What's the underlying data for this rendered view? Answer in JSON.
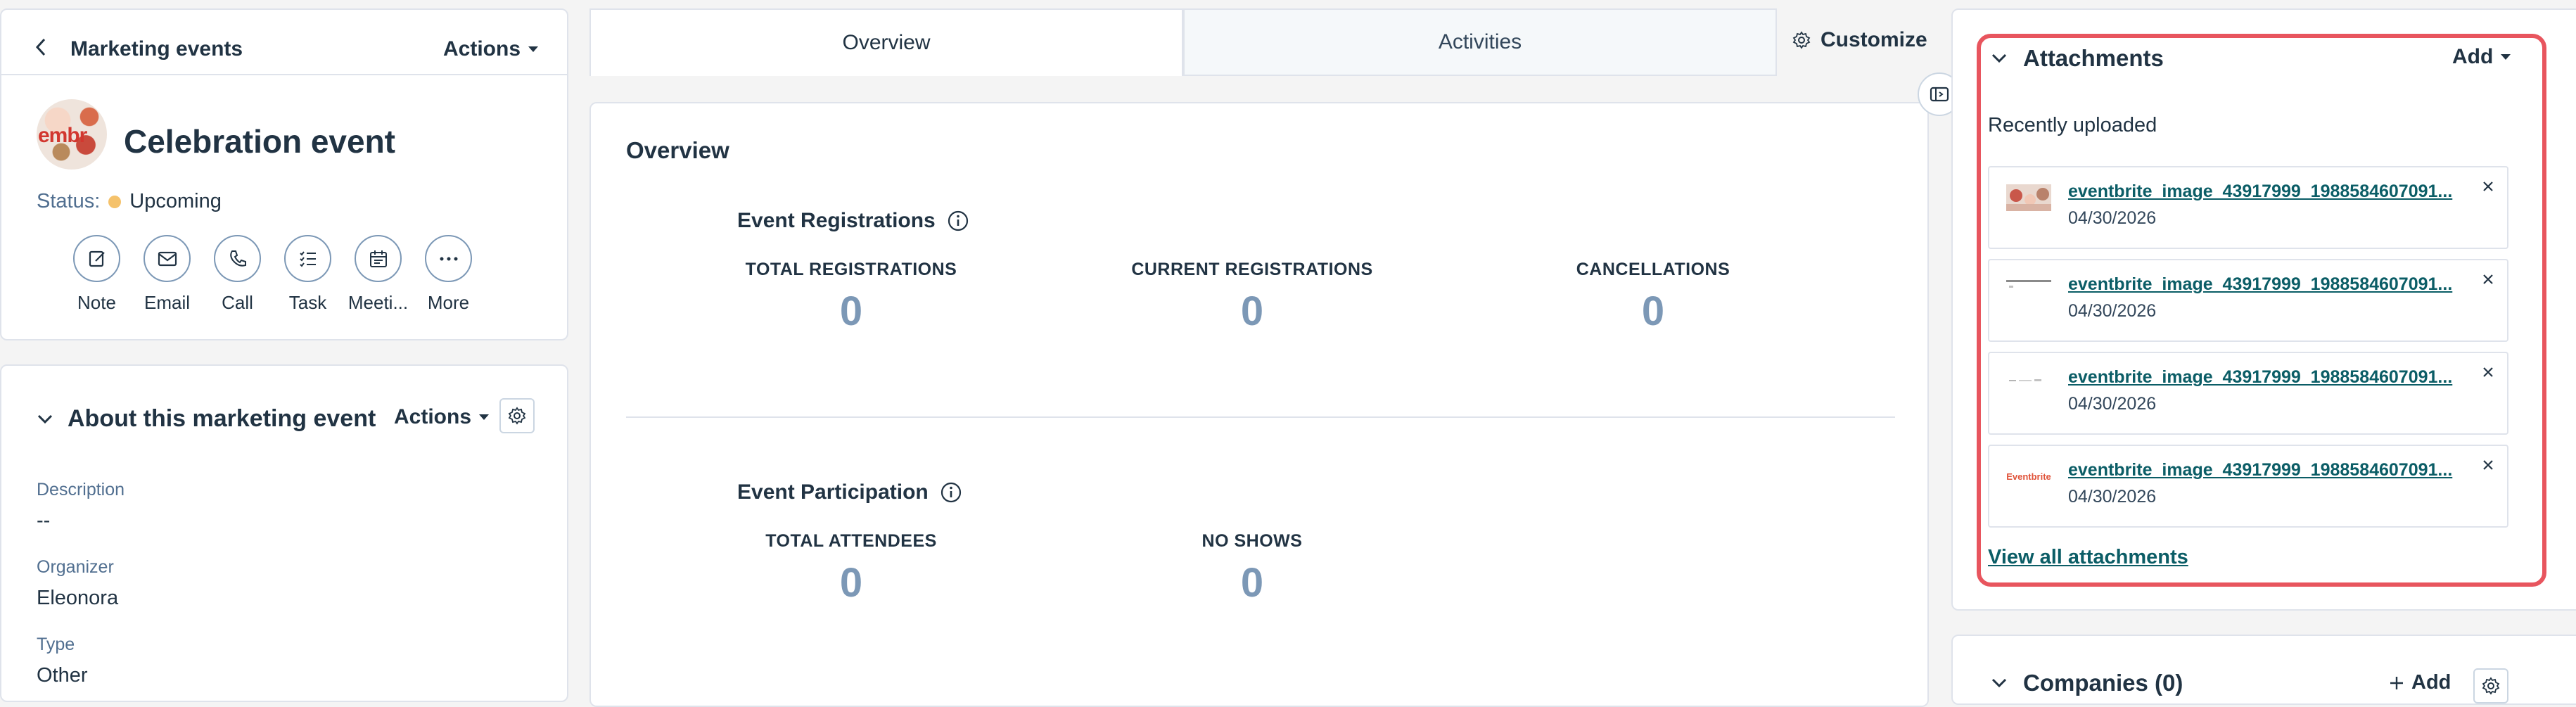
{
  "record_header": {
    "back_label": "Marketing events",
    "actions_label": "Actions",
    "avatar_text": "embr",
    "record_name": "Celebration event",
    "status_label": "Status:",
    "status_value": "Upcoming",
    "status_color": "#f5c26b"
  },
  "quick_actions": [
    {
      "label": "Note",
      "icon": "note-icon"
    },
    {
      "label": "Email",
      "icon": "email-icon"
    },
    {
      "label": "Call",
      "icon": "call-icon"
    },
    {
      "label": "Task",
      "icon": "task-icon"
    },
    {
      "label": "Meeti...",
      "icon": "meeting-icon"
    },
    {
      "label": "More",
      "icon": "more-icon"
    }
  ],
  "about": {
    "title": "About this marketing event",
    "actions_label": "Actions",
    "properties": [
      {
        "label": "Description",
        "value": "--"
      },
      {
        "label": "Organizer",
        "value": "Eleonora"
      },
      {
        "label": "Type",
        "value": "Other"
      }
    ]
  },
  "tabs": [
    {
      "label": "Overview",
      "active": true
    },
    {
      "label": "Activities",
      "active": false
    }
  ],
  "customize_label": "Customize",
  "overview": {
    "title": "Overview",
    "registrations": {
      "title": "Event Registrations",
      "stats": [
        {
          "label": "TOTAL REGISTRATIONS",
          "value": "0"
        },
        {
          "label": "CURRENT REGISTRATIONS",
          "value": "0"
        },
        {
          "label": "CANCELLATIONS",
          "value": "0"
        }
      ]
    },
    "participation": {
      "title": "Event Participation",
      "stats": [
        {
          "label": "TOTAL ATTENDEES",
          "value": "0"
        },
        {
          "label": "NO SHOWS",
          "value": "0"
        }
      ]
    }
  },
  "attachments": {
    "title": "Attachments",
    "add_label": "Add",
    "recent_label": "Recently uploaded",
    "items": [
      {
        "name": "eventbrite_image_43917999_1988584607091...",
        "date": "04/30/2026",
        "thumb_text": ""
      },
      {
        "name": "eventbrite_image_43917999_1988584607091...",
        "date": "04/30/2026",
        "thumb_text": ""
      },
      {
        "name": "eventbrite_image_43917999_1988584607091...",
        "date": "04/30/2026",
        "thumb_text": ""
      },
      {
        "name": "eventbrite_image_43917999_1988584607091...",
        "date": "04/30/2026",
        "thumb_text": "Eventbrite"
      }
    ],
    "view_all_label": "View all attachments",
    "highlight_color": "#e8555e",
    "link_color": "#0b5d66"
  },
  "companies": {
    "title": "Companies (0)",
    "add_label": "Add"
  }
}
